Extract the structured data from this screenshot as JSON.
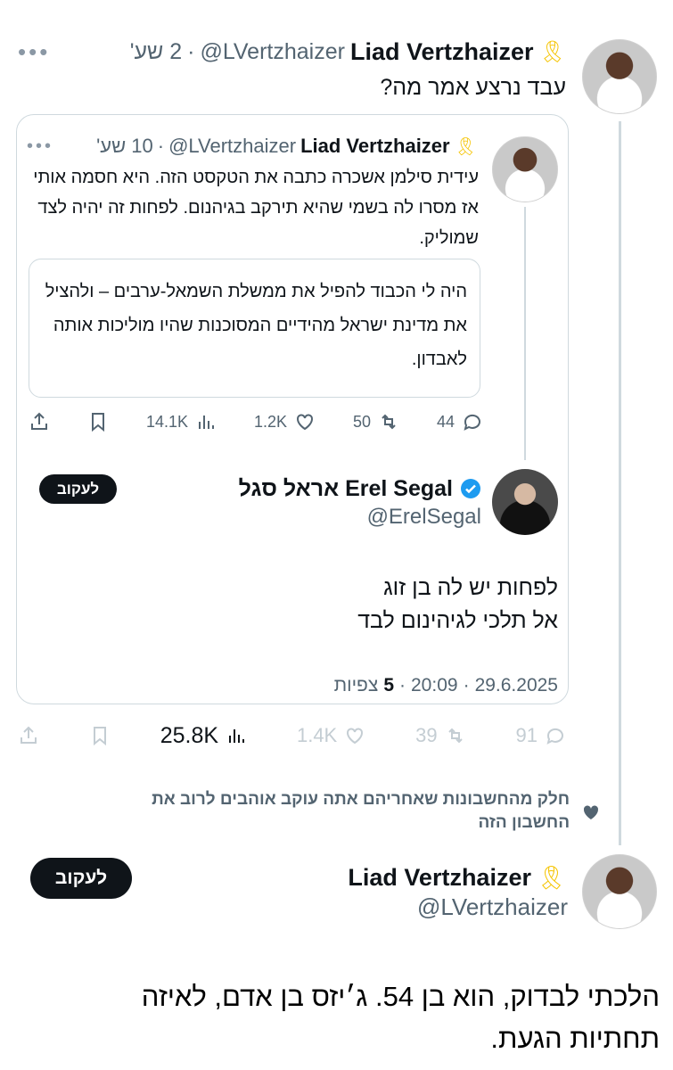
{
  "post": {
    "author_name": "Liad Vertzhaizer",
    "handle": "@LVertzhaizer",
    "time": "2 שע'",
    "ribbon": "🎗",
    "text": "עבד נרצע אמר מה?"
  },
  "quote": {
    "author_name": "Liad Vertzhaizer",
    "handle": "@LVertzhaizer",
    "time": "10 שע'",
    "text": "עידית סילמן אשכרה כתבה את הטקסט הזה. היא חסמה אותי אז מסרו לה בשמי שהיא תירקב בגיהנום. לפחות זה יהיה לצד שמוליק.",
    "inner_quote_text": "היה לי הכבוד להפיל את ממשלת השמאל-ערבים – ולהציל את מדינת ישראל מהידיים המסוכנות שהיו מוליכות אותה לאבדון.",
    "stats": {
      "replies": "44",
      "reposts": "50",
      "likes": "1.2K",
      "views": "14.1K"
    },
    "reply": {
      "author_name": "Erel Segal אראל סגל",
      "handle": "@ErelSegal",
      "follow_label": "לעקוב",
      "text_line1": "לפחות יש לה בן זוג",
      "text_line2": "אל תלכי לגיהינום לבד",
      "date": "29.6.2025",
      "time": "20:09",
      "views_count": "5",
      "views_label": "צפיות"
    }
  },
  "post_stats": {
    "replies": "91",
    "reposts": "39",
    "likes": "1.4K",
    "views": "25.8K"
  },
  "social_context": "חלק מהחשבונות שאחריהם אתה עוקב אוהבים לרוב את החשבון הזה",
  "profile": {
    "author_name": "Liad Vertzhaizer",
    "handle": "@LVertzhaizer",
    "follow_label": "לעקוב"
  },
  "caption": "הלכתי לבדוק, הוא בן 54. ג׳יזס בן אדם, לאיזה תחתיות הגעת.",
  "colors": {
    "verified": "#1d9bf0",
    "ribbon": "#f5c400",
    "button": "#0f1419"
  }
}
